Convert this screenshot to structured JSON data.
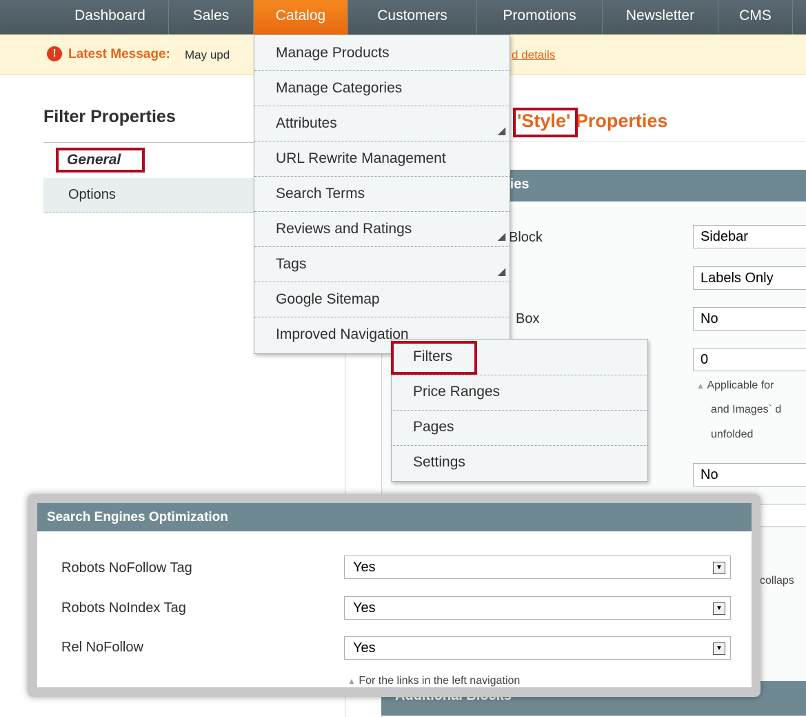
{
  "nav": {
    "items": [
      "Dashboard",
      "Sales",
      "Catalog",
      "Customers",
      "Promotions",
      "Newsletter",
      "CMS"
    ],
    "active": "Catalog"
  },
  "message": {
    "label": "Latest Message:",
    "text": "May upd",
    "link": "d details"
  },
  "left": {
    "title": "Filter Properties",
    "tabs": [
      "General",
      "Options"
    ]
  },
  "right": {
    "title_style": "'Style'",
    "title_rest": "Properties",
    "section_head": "ties",
    "rows": [
      {
        "label": "Block",
        "value": "Sidebar"
      },
      {
        "label": "",
        "value": "Labels Only"
      },
      {
        "label": "Box",
        "value": "No"
      },
      {
        "label": "",
        "value": "0"
      }
    ],
    "note_lines": [
      "Applicable for",
      "and Images` d",
      "unfolded"
    ],
    "row5_value": "No",
    "row6_value": "n",
    "row7_note": "collaps",
    "additional_blocks": "Additional Blocks"
  },
  "catalog_menu": {
    "items": [
      {
        "label": "Manage Products",
        "has_sub": false
      },
      {
        "label": "Manage Categories",
        "has_sub": false
      },
      {
        "label": "Attributes",
        "has_sub": true
      },
      {
        "label": "URL Rewrite Management",
        "has_sub": false
      },
      {
        "label": "Search Terms",
        "has_sub": false
      },
      {
        "label": "Reviews and Ratings",
        "has_sub": true
      },
      {
        "label": "Tags",
        "has_sub": true
      },
      {
        "label": "Google Sitemap",
        "has_sub": false
      },
      {
        "label": "Improved Navigation",
        "has_sub": true
      }
    ]
  },
  "submenu": {
    "items": [
      "Filters",
      "Price Ranges",
      "Pages",
      "Settings"
    ]
  },
  "seo": {
    "title": "Search Engines Optimization",
    "rows": [
      {
        "label": "Robots NoFollow Tag",
        "value": "Yes"
      },
      {
        "label": "Robots NoIndex Tag",
        "value": "Yes"
      },
      {
        "label": "Rel NoFollow",
        "value": "Yes"
      }
    ],
    "note": "For the links in the left navigation"
  },
  "colors": {
    "nav_bg": "#4f5d64",
    "active_tab": "#f07a1a",
    "accent": "#e3661d",
    "highlight_box": "#b10a1d",
    "panel_head": "#6f8992"
  }
}
